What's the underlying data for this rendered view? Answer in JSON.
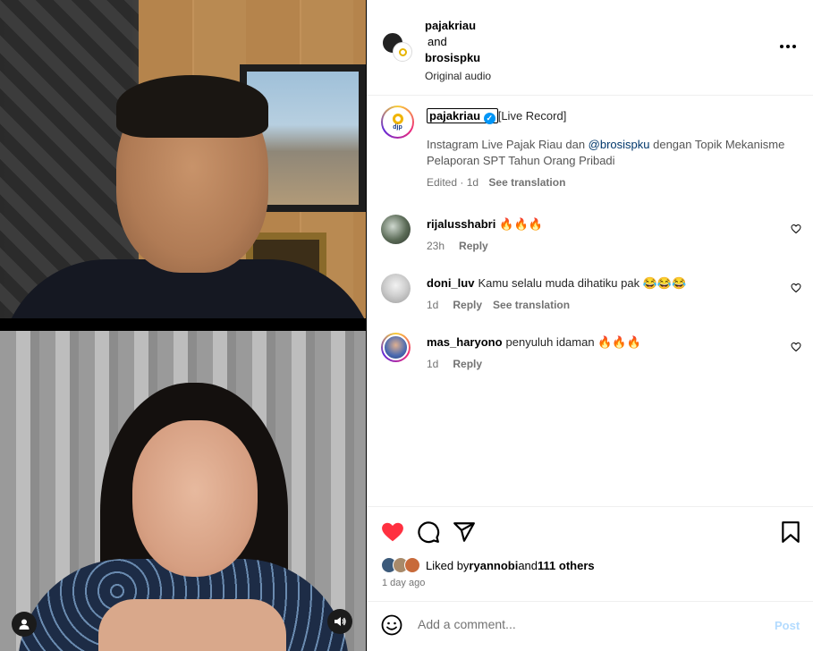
{
  "header": {
    "user1": "pajakriau",
    "and": "and",
    "user2": "brosispku",
    "audio": "Original audio"
  },
  "caption": {
    "username": "pajakriau",
    "tag": "[Live Record]",
    "text_before": "Instagram Live Pajak Riau dan ",
    "mention": "@brosispku",
    "text_after": " dengan Topik Mekanisme Pelaporan SPT Tahun Orang Pribadi",
    "meta_time": "Edited · 1d",
    "see_translation": "See translation",
    "avatar_text": "djp"
  },
  "comments": [
    {
      "user": "rijalusshabri",
      "text": "🔥🔥🔥",
      "time": "23h",
      "reply": "Reply",
      "translation": ""
    },
    {
      "user": "doni_luv",
      "text": "Kamu selalu muda dihatiku pak 😂😂😂",
      "time": "1d",
      "reply": "Reply",
      "translation": "See translation"
    },
    {
      "user": "mas_haryono",
      "text": "penyuluh idaman 🔥🔥🔥",
      "time": "1d",
      "reply": "Reply",
      "translation": ""
    }
  ],
  "likes": {
    "prefix": "Liked by ",
    "user": "ryannobi",
    "middle": " and ",
    "others": "111 others",
    "time": "1 day ago"
  },
  "comment_box": {
    "placeholder": "Add a comment...",
    "post_label": "Post"
  },
  "colors": {
    "like_red": "#ff3040",
    "verified_blue": "#0095f6",
    "mention": "#00376b",
    "post_disabled": "#b3dbff"
  }
}
